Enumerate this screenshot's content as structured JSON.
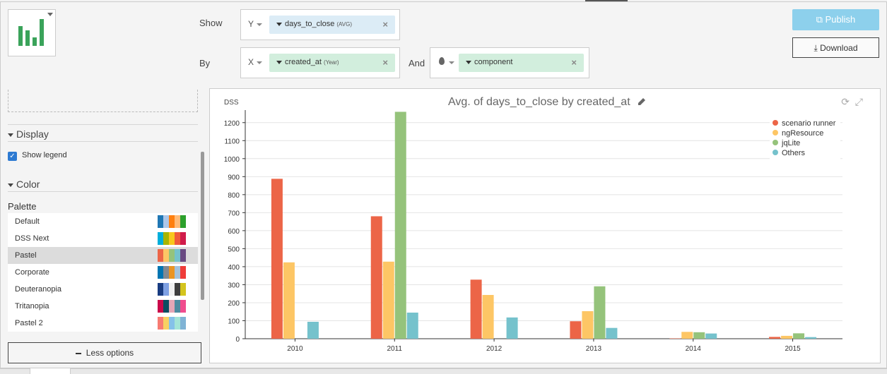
{
  "shelf": {
    "show_label": "Show",
    "by_label": "By",
    "and_label": "And",
    "y_axis": {
      "letter": "Y",
      "column": "days_to_close",
      "agg": "(AVG)"
    },
    "x_axis": {
      "letter": "X",
      "column": "created_at",
      "agg": "(Year)"
    },
    "color_dim": {
      "column": "component"
    }
  },
  "actions": {
    "publish": "Publish",
    "download": "Download"
  },
  "options": {
    "display_section": "Display",
    "show_legend": "Show legend",
    "color_section": "Color",
    "palette_title": "Palette",
    "palettes": [
      {
        "name": "Default",
        "colors": [
          "#1f77b4",
          "#aec7e8",
          "#ff7f0e",
          "#ffbb78",
          "#2ca02c"
        ]
      },
      {
        "name": "DSS Next",
        "colors": [
          "#00aedb",
          "#a8b400",
          "#f8c71c",
          "#ef5a3b",
          "#d01c4b"
        ]
      },
      {
        "name": "Pastel",
        "colors": [
          "#ec6547",
          "#fdc665",
          "#95c37b",
          "#75c2cc",
          "#694a82"
        ]
      },
      {
        "name": "Corporate",
        "colors": [
          "#0075b2",
          "#818991",
          "#ea9423",
          "#a4c2db",
          "#ef3c39"
        ]
      },
      {
        "name": "Deuteranopia",
        "colors": [
          "#193c81",
          "#7ea0e3",
          "#f0f0f0",
          "#3e3e3e",
          "#d4c41e"
        ]
      },
      {
        "name": "Tritanopia",
        "colors": [
          "#ca0849",
          "#0b4d61",
          "#e4a6b6",
          "#4d8ba0",
          "#f04d8e"
        ]
      },
      {
        "name": "Pastel 2",
        "colors": [
          "#f77b72",
          "#f7d062",
          "#85c1e9",
          "#a3e4d7",
          "#7fb3d5"
        ]
      }
    ],
    "selected_palette": "Pastel",
    "less_options": "Less options"
  },
  "chart_header": {
    "tag": "DSS",
    "title": "Avg. of days_to_close by created_at"
  },
  "chart_data": {
    "type": "bar",
    "title": "Avg. of days_to_close by created_at",
    "xlabel": "",
    "ylabel": "",
    "categories": [
      "2010",
      "2011",
      "2012",
      "2013",
      "2014",
      "2015"
    ],
    "ylim": [
      0,
      1250
    ],
    "yticks": [
      0,
      100,
      200,
      300,
      400,
      500,
      600,
      700,
      800,
      900,
      1000,
      1100,
      1200
    ],
    "legend_position": "top-right",
    "grid": true,
    "series": [
      {
        "name": "scenario runner",
        "color": "#ec6547",
        "values": [
          888,
          680,
          328,
          97,
          2,
          10
        ]
      },
      {
        "name": "ngResource",
        "color": "#fdc665",
        "values": [
          424,
          428,
          243,
          153,
          38,
          16
        ]
      },
      {
        "name": "jqLite",
        "color": "#95c37b",
        "values": [
          0,
          1260,
          0,
          291,
          36,
          30
        ]
      },
      {
        "name": "Others",
        "color": "#75c2cc",
        "values": [
          94,
          145,
          118,
          60,
          29,
          9
        ]
      }
    ]
  }
}
